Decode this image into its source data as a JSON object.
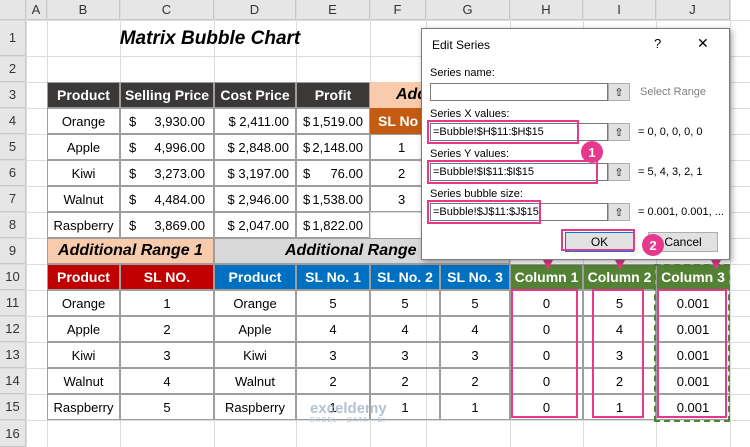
{
  "columns": [
    "A",
    "B",
    "C",
    "D",
    "E",
    "F",
    "G",
    "H",
    "I",
    "J"
  ],
  "rows": [
    "1",
    "2",
    "3",
    "4",
    "5",
    "6",
    "7",
    "8",
    "9",
    "10",
    "11",
    "12",
    "13",
    "14",
    "15",
    "16"
  ],
  "title": "Matrix Bubble Chart",
  "table1": {
    "headers": [
      "Product",
      "Selling Price",
      "Cost Price",
      "Profit"
    ],
    "rows": [
      {
        "product": "Orange",
        "sp_sym": "$",
        "sp": "3,930.00",
        "cp": "$ 2,411.00",
        "pf_sym": "$",
        "pf": "1,519.00"
      },
      {
        "product": "Apple",
        "sp_sym": "$",
        "sp": "4,996.00",
        "cp": "$ 2,848.00",
        "pf_sym": "$",
        "pf": "2,148.00"
      },
      {
        "product": "Kiwi",
        "sp_sym": "$",
        "sp": "3,273.00",
        "cp": "$ 3,197.00",
        "pf_sym": "$",
        "pf": "76.00"
      },
      {
        "product": "Walnut",
        "sp_sym": "$",
        "sp": "4,484.00",
        "cp": "$ 2,946.00",
        "pf_sym": "$",
        "pf": "1,538.00"
      },
      {
        "product": "Raspberry",
        "sp_sym": "$",
        "sp": "3,869.00",
        "cp": "$ 2,047.00",
        "pf_sym": "$",
        "pf": "1,822.00"
      }
    ]
  },
  "side_table": {
    "title": "Add",
    "header": "SL No",
    "values": [
      "1",
      "2",
      "3"
    ]
  },
  "range1_title": "Additional Range 1",
  "range2_title": "Additional Range",
  "table2": {
    "headers": [
      "Product",
      "SL NO.",
      "Product",
      "SL No. 1",
      "SL No. 2",
      "SL No. 3",
      "Column 1",
      "Column 2",
      "Column 3"
    ],
    "rows": [
      [
        "Orange",
        "1",
        "Orange",
        "5",
        "5",
        "5",
        "0",
        "5",
        "0.001"
      ],
      [
        "Apple",
        "2",
        "Apple",
        "4",
        "4",
        "4",
        "0",
        "4",
        "0.001"
      ],
      [
        "Kiwi",
        "3",
        "Kiwi",
        "3",
        "3",
        "3",
        "0",
        "3",
        "0.001"
      ],
      [
        "Walnut",
        "4",
        "Walnut",
        "2",
        "2",
        "2",
        "0",
        "2",
        "0.001"
      ],
      [
        "Raspberry",
        "5",
        "Raspberry",
        "1",
        "1",
        "1",
        "0",
        "1",
        "0.001"
      ]
    ]
  },
  "dialog": {
    "title": "Edit Series",
    "help": "?",
    "close": "✕",
    "series_name_label": "Series name:",
    "series_name_value": "",
    "select_range": "Select Range",
    "x_label": "Series X values:",
    "x_value": "=Bubble!$H$11:$H$15",
    "x_result": "= 0, 0, 0, 0, 0",
    "y_label": "Series Y values:",
    "y_value": "=Bubble!$I$11:$I$15",
    "y_result": "= 5, 4, 3, 2, 1",
    "size_label": "Series bubble size:",
    "size_value": "=Bubble!$J$11:$J$15",
    "size_result": "= 0.001, 0.001, ...",
    "ok": "OK",
    "cancel": "Cancel"
  },
  "badges": [
    "1",
    "2"
  ],
  "watermark": {
    "name": "exceldemy",
    "tagline": "EXCEL · DATA · BI"
  }
}
